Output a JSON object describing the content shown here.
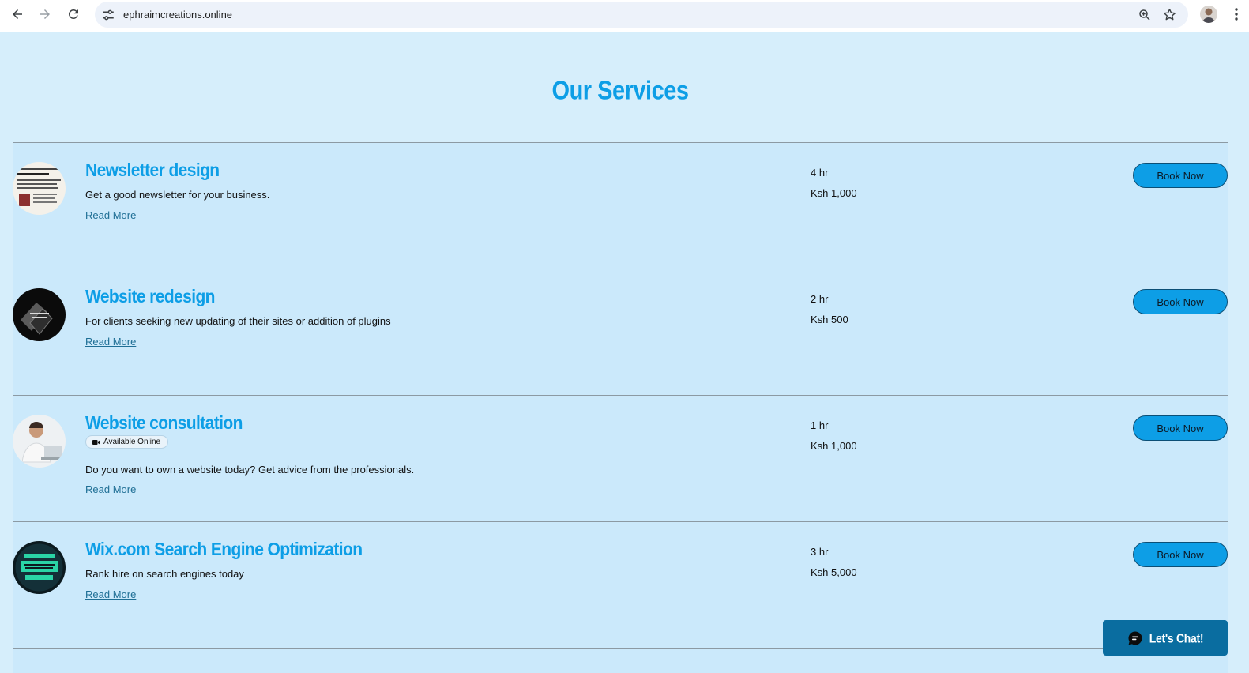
{
  "browser": {
    "url": "ephraimcreations.online",
    "icons": {
      "back": "arrow-left-icon",
      "forward": "arrow-right-icon",
      "reload": "reload-icon",
      "site_settings": "tune-icon",
      "zoom": "zoom-icon",
      "bookmark": "star-icon",
      "profile": "avatar",
      "menu": "kebab-menu-icon"
    }
  },
  "page": {
    "title": "Our Services"
  },
  "services": [
    {
      "name": "Newsletter design",
      "badge": "",
      "description": "Get a good newsletter for your business.",
      "read_more": "Read More",
      "duration": "4 hr",
      "price": "Ksh 1,000",
      "book_label": "Book Now"
    },
    {
      "name": "Website redesign",
      "badge": "",
      "description": "For clients seeking new updating of their sites or addition of plugins",
      "read_more": "Read More",
      "duration": "2 hr",
      "price": "Ksh 500",
      "book_label": "Book Now"
    },
    {
      "name": "Website consultation",
      "badge": "Available Online",
      "description": "Do you want to own a website today? Get advice from the professionals.",
      "read_more": "Read More",
      "duration": "1 hr",
      "price": "Ksh 1,000",
      "book_label": "Book Now"
    },
    {
      "name": "Wix.com Search Engine Optimization",
      "badge": "",
      "description": "Rank hire on search engines today",
      "read_more": "Read More",
      "duration": "3 hr",
      "price": "Ksh 5,000",
      "book_label": "Book Now"
    }
  ],
  "chat": {
    "label": "Let's Chat!"
  },
  "colors": {
    "accent": "#0d9ee6",
    "page_bg": "#d6eefb",
    "row_bg": "#cbe9fb",
    "chat_bg": "#0a6da0"
  }
}
